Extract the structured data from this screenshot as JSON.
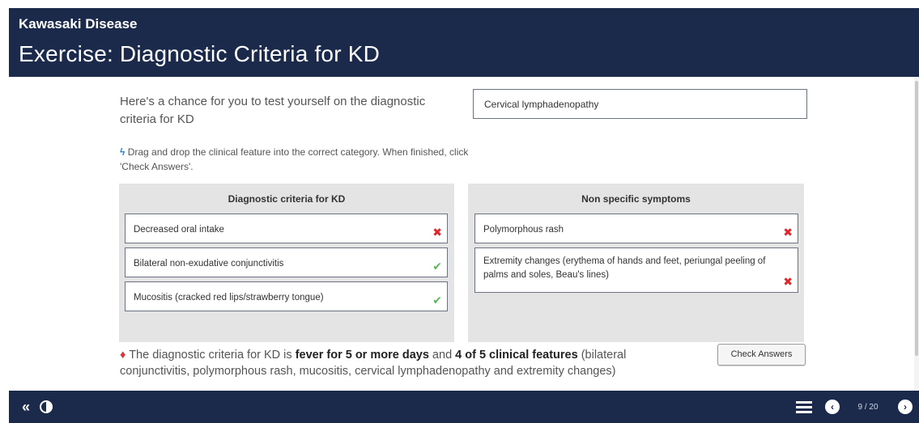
{
  "header": {
    "course_title": "Kawasaki Disease",
    "page_title": "Exercise: Diagnostic Criteria for KD"
  },
  "intro": {
    "text": "Here's a chance for you to test yourself on the diagnostic criteria for KD",
    "instruction": "Drag and drop the clinical feature into the correct category. When finished, click 'Check Answers'."
  },
  "draggable_feature": "Cervical lymphadenopathy",
  "categories": [
    {
      "title": "Diagnostic criteria for KD",
      "items": [
        {
          "label": "Decreased oral intake",
          "status": "wrong"
        },
        {
          "label": "Bilateral non-exudative conjunctivitis",
          "status": "correct"
        },
        {
          "label": "Mucositis (cracked red lips/strawberry tongue)",
          "status": "correct"
        }
      ]
    },
    {
      "title": "Non specific symptoms",
      "items": [
        {
          "label": "Polymorphous rash",
          "status": "wrong"
        },
        {
          "label": "Extremity changes (erythema of hands and feet, periungal peeling of palms and soles, Beau's lines)",
          "status": "wrong"
        }
      ]
    }
  ],
  "note": {
    "part1": "The diagnostic criteria for KD is ",
    "bold1": "fever for 5 or more days",
    "part2": " and ",
    "bold2": "4 of 5 clinical features",
    "part3": " (bilateral conjunctivitis, polymorphous rash, mucositis, cervical lymphadenopathy and extremity changes)"
  },
  "check_answers_label": "Check Answers",
  "bottombar": {
    "collapse_icon": "«",
    "contrast_icon": "contrast-icon",
    "menu_icon": "menu-icon",
    "page_indicator": "9 / 20"
  },
  "colors": {
    "header_bg": "#1b2a4b",
    "category_bg": "#e4e4e4",
    "wrong": "#e0262a",
    "correct": "#5cb85c"
  }
}
